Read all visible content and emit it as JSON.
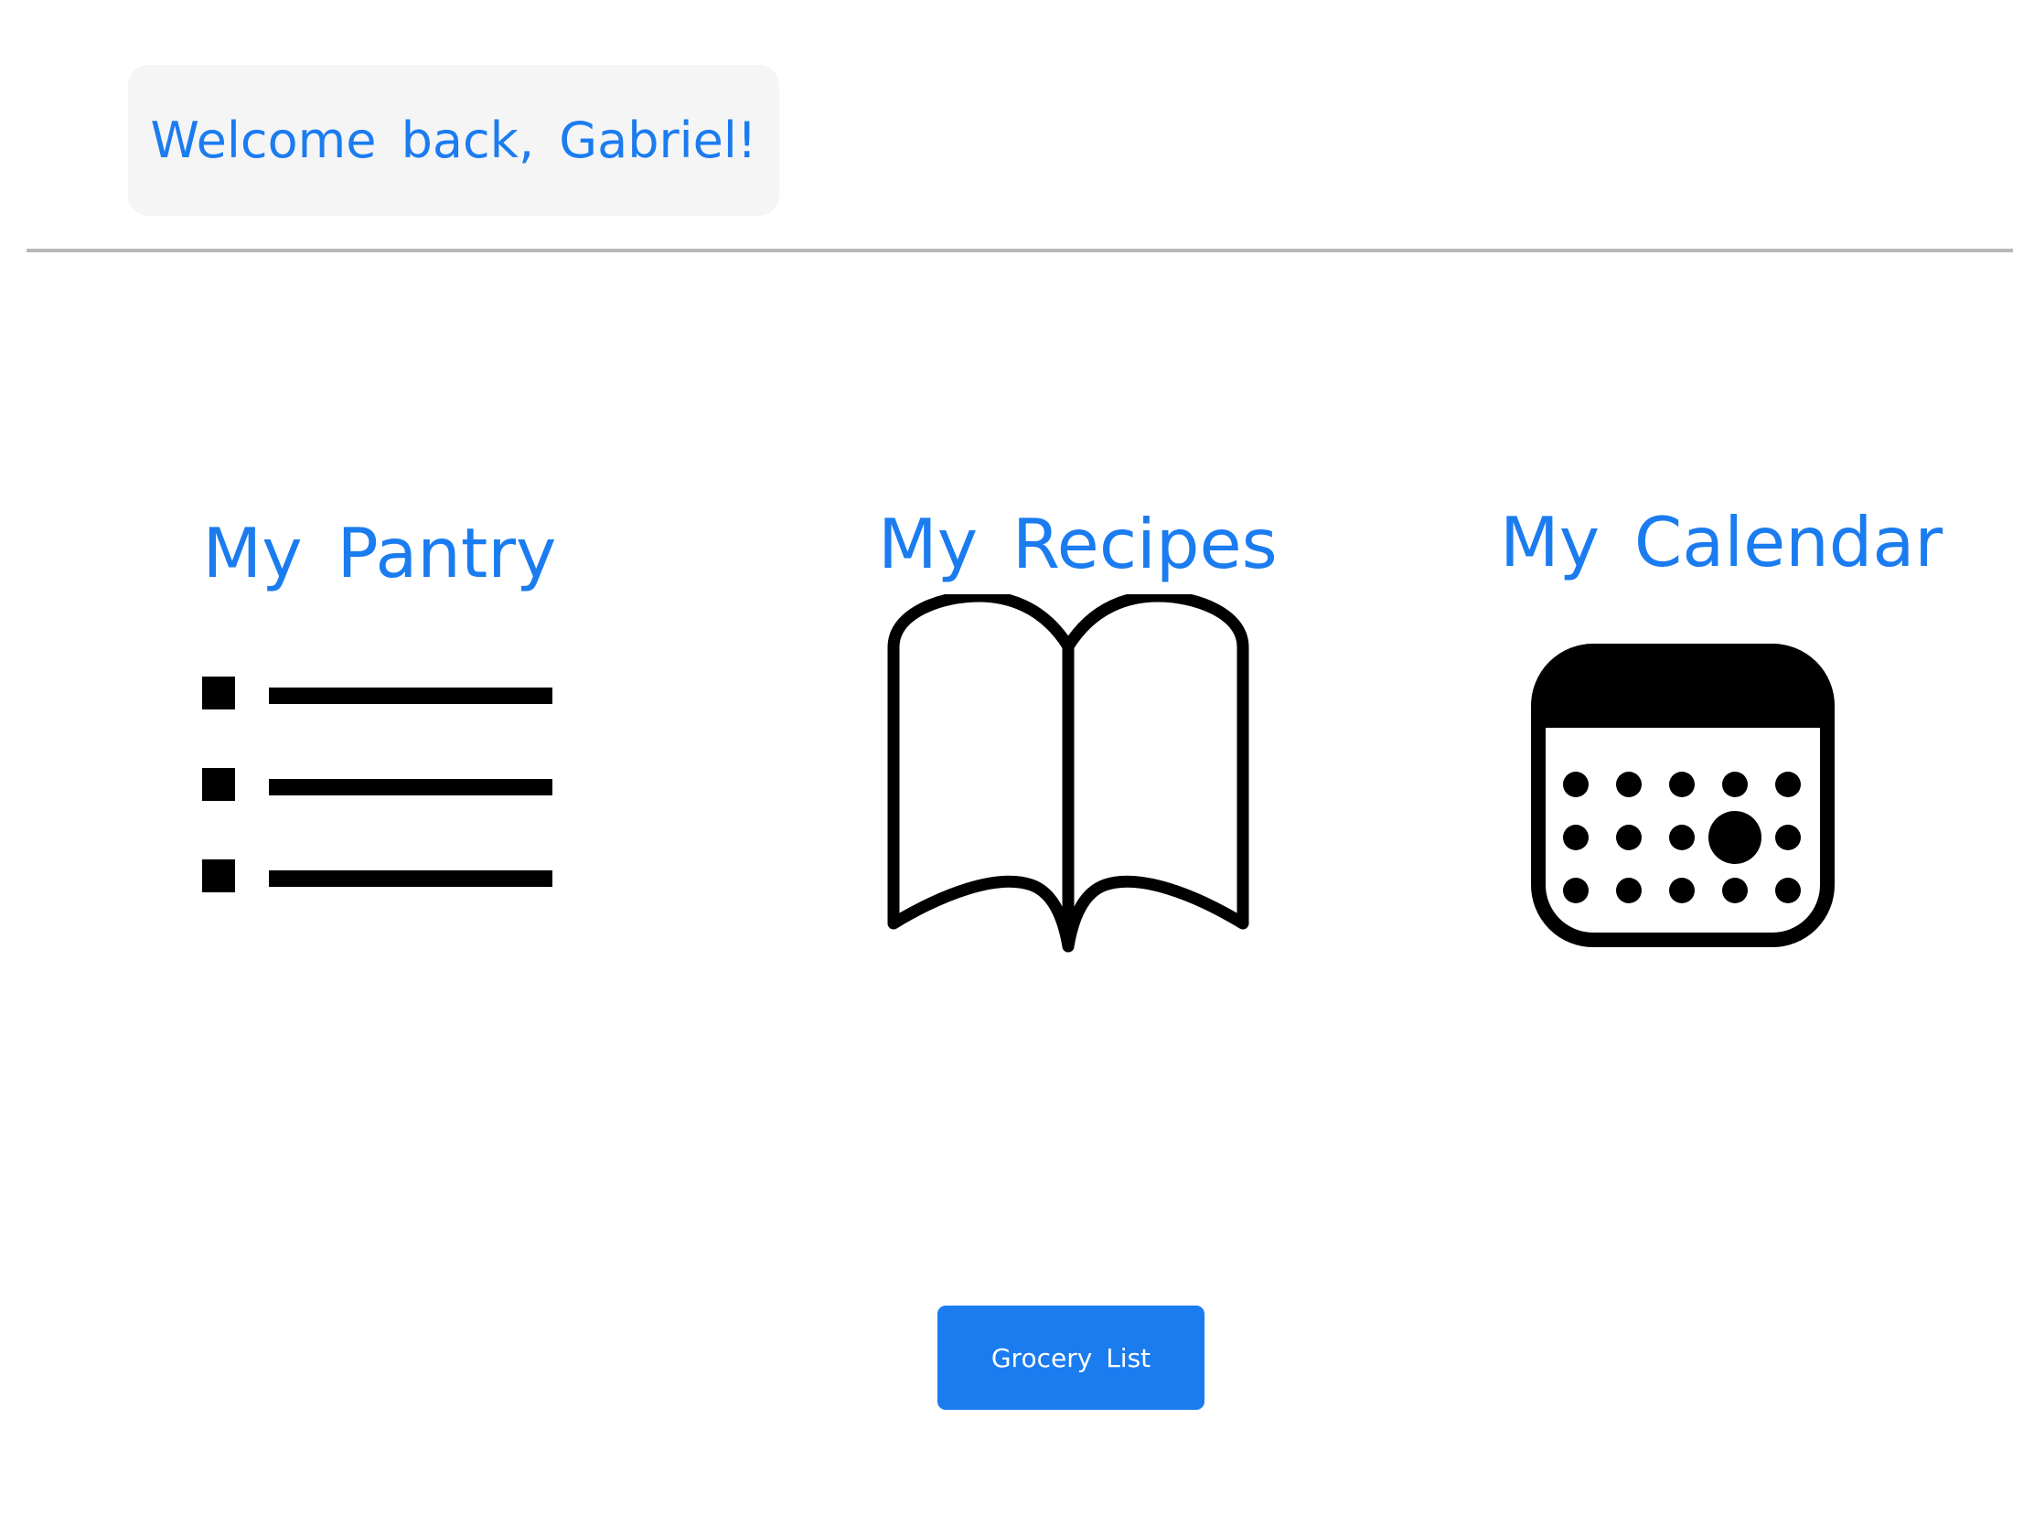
{
  "header": {
    "welcome_text": "Welcome back, Gabriel!"
  },
  "tiles": [
    {
      "label": "My Pantry",
      "icon": "list-icon"
    },
    {
      "label": "My Recipes",
      "icon": "open-book-icon"
    },
    {
      "label": "My Calendar",
      "icon": "calendar-icon"
    }
  ],
  "actions": {
    "grocery_list_label": "Grocery List"
  },
  "colors": {
    "accent": "#1b7cf0",
    "card_background": "#f5f5f5",
    "divider": "#b7b7b7",
    "icon": "#000000"
  }
}
